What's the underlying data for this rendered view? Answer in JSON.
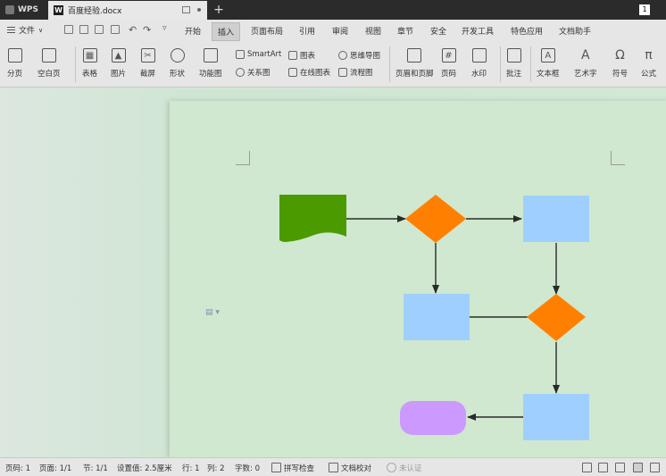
{
  "titlebar": {
    "app_name": "WPS",
    "doc_tab": "百度经验.docx",
    "new_tab": "+",
    "window_count": "1"
  },
  "menubar": {
    "file": "文件",
    "items": [
      "开始",
      "插入",
      "页面布局",
      "引用",
      "审阅",
      "视图",
      "章节",
      "安全",
      "开发工具",
      "特色应用",
      "文档助手"
    ],
    "active": "插入"
  },
  "ribbon": {
    "page_break": "分页",
    "blank_page": "空白页",
    "table": "表格",
    "picture": "图片",
    "screenshot": "截屏",
    "shape": "形状",
    "function_chart": "功能图",
    "smartart": "SmartArt",
    "chart": "图表",
    "mindmap": "思维导图",
    "relation": "关系图",
    "online_chart": "在线图表",
    "flowchart": "流程图",
    "header_footer": "页眉和页脚",
    "page_number": "页码",
    "watermark": "水印",
    "comment": "批注",
    "textbox": "文本框",
    "wordart": "艺术字",
    "symbol": "符号",
    "formula": "公式"
  },
  "flowchart": {
    "colors": {
      "document": "#4a9a00",
      "decision": "#ff8000",
      "process": "#9fcfff",
      "terminal": "#cc99ff",
      "connector": "#2a2a2a"
    }
  },
  "statusbar": {
    "page_num": "页码: 1",
    "pages": "页面: 1/1",
    "section": "节: 1/1",
    "setting": "设置值: 2.5厘米",
    "row": "行: 1",
    "col": "列: 2",
    "words": "字数: 0",
    "spell": "拼写检查",
    "proof": "文档校对",
    "cert": "未认证"
  }
}
